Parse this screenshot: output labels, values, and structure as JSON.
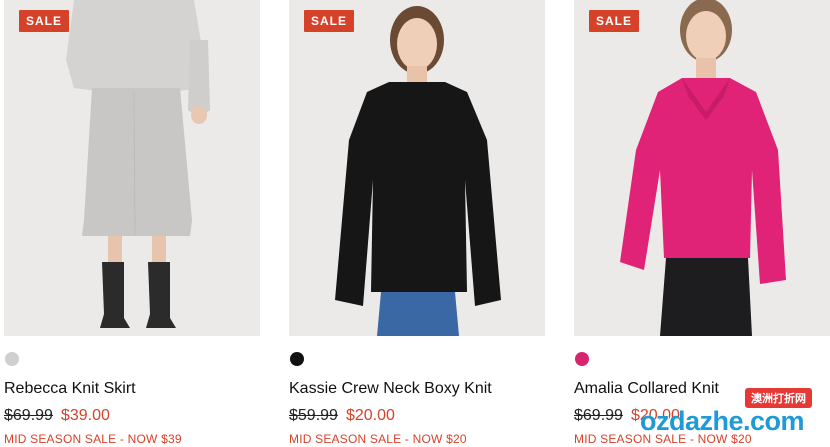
{
  "products": [
    {
      "badge": "SALE",
      "name": "Rebecca Knit Skirt",
      "was_price": "$69.99",
      "now_price": "$39.00",
      "promo": "MID SEASON SALE - NOW $39",
      "swatch_color": "#cfcfcf",
      "image_desc": "grey-knit-skirt-photo"
    },
    {
      "badge": "SALE",
      "name": "Kassie Crew Neck Boxy Knit",
      "was_price": "$59.99",
      "now_price": "$20.00",
      "promo": "MID SEASON SALE - NOW $20",
      "swatch_color": "#111111",
      "image_desc": "black-knit-sweater-photo"
    },
    {
      "badge": "SALE",
      "name": "Amalia Collared Knit",
      "was_price": "$69.99",
      "now_price": "$20.00",
      "promo": "MID SEASON SALE - NOW $20",
      "swatch_color": "#d6246e",
      "image_desc": "pink-collared-knit-photo"
    }
  ],
  "watermark": {
    "logo_text": "ozdazhe.com",
    "tag_text": "澳洲打折网"
  },
  "colors": {
    "sale_red": "#d64229",
    "photo_bg": "#eceae8"
  }
}
